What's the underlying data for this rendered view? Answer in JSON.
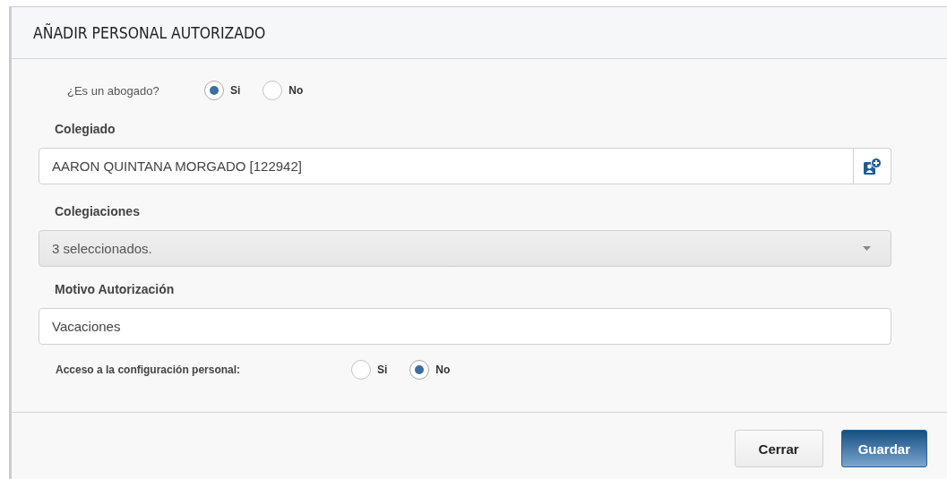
{
  "dialog": {
    "title": "AÑADIR PERSONAL AUTORIZADO"
  },
  "lawyer_question": {
    "label": "¿Es un abogado?",
    "options": [
      {
        "label": "Si",
        "selected": true
      },
      {
        "label": "No",
        "selected": false
      }
    ]
  },
  "colegiado": {
    "label": "Colegiado",
    "value": "AARON QUINTANA MORGADO [122942]"
  },
  "colegiaciones": {
    "label": "Colegiaciones",
    "value": "3 seleccionados.",
    "disabled": true
  },
  "motivo": {
    "label": "Motivo Autorización",
    "value": "Vacaciones"
  },
  "access_question": {
    "label": "Acceso a la configuración personal:",
    "options": [
      {
        "label": "Si",
        "selected": false
      },
      {
        "label": "No",
        "selected": true
      }
    ]
  },
  "buttons": [
    {
      "label": "Cerrar",
      "kind": "default"
    },
    {
      "label": "Guardar",
      "kind": "primary"
    }
  ]
}
